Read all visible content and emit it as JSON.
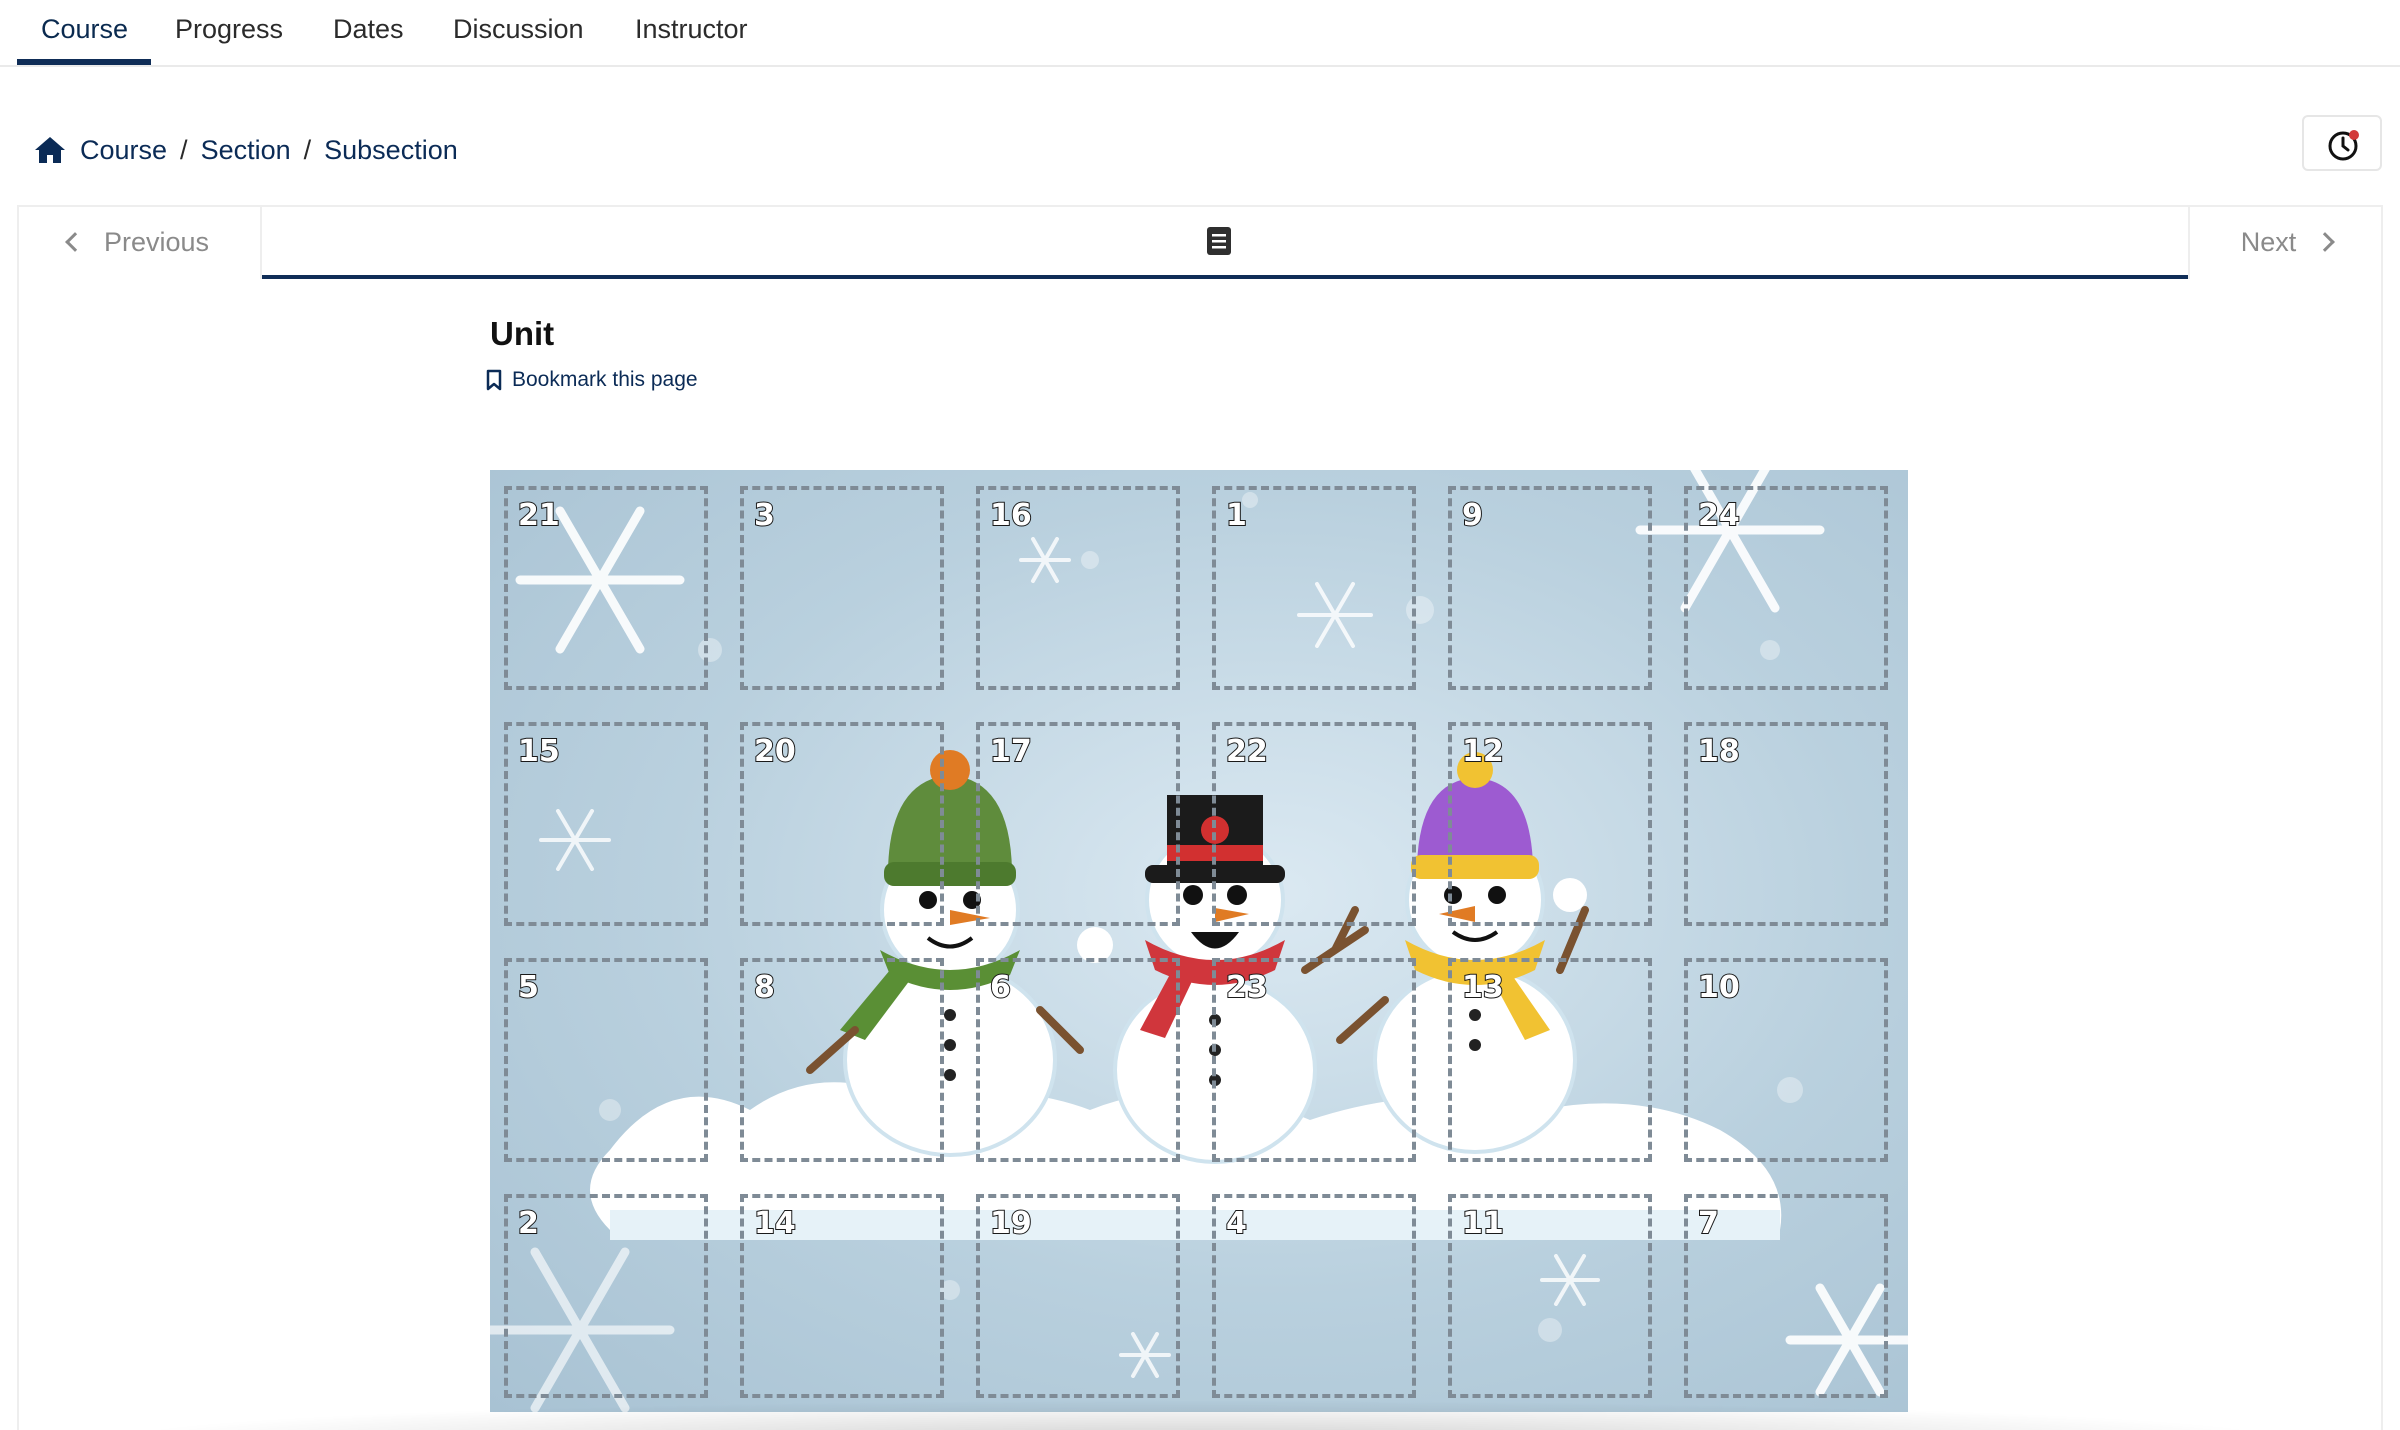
{
  "tabs": [
    {
      "label": "Course"
    },
    {
      "label": "Progress"
    },
    {
      "label": "Dates"
    },
    {
      "label": "Discussion"
    },
    {
      "label": "Instructor"
    }
  ],
  "breadcrumb": [
    "Course",
    "Section",
    "Subsection"
  ],
  "breadcrumb_separator": "/",
  "sequence_nav": {
    "previous": "Previous",
    "next": "Next"
  },
  "unit": {
    "title": "Unit",
    "bookmark": "Bookmark this page"
  },
  "calendar": {
    "rows": [
      [
        "21",
        "3",
        "16",
        "1",
        "9",
        "24"
      ],
      [
        "15",
        "20",
        "17",
        "22",
        "12",
        "18"
      ],
      [
        "5",
        "8",
        "6",
        "23",
        "13",
        "10"
      ],
      [
        "2",
        "14",
        "19",
        "4",
        "11",
        "7"
      ]
    ],
    "illustration": "three-snowmen-icon"
  },
  "colors": {
    "accent": "#0f2d57",
    "link": "#0b2b56",
    "calendar_bg": "#b9d0de"
  }
}
